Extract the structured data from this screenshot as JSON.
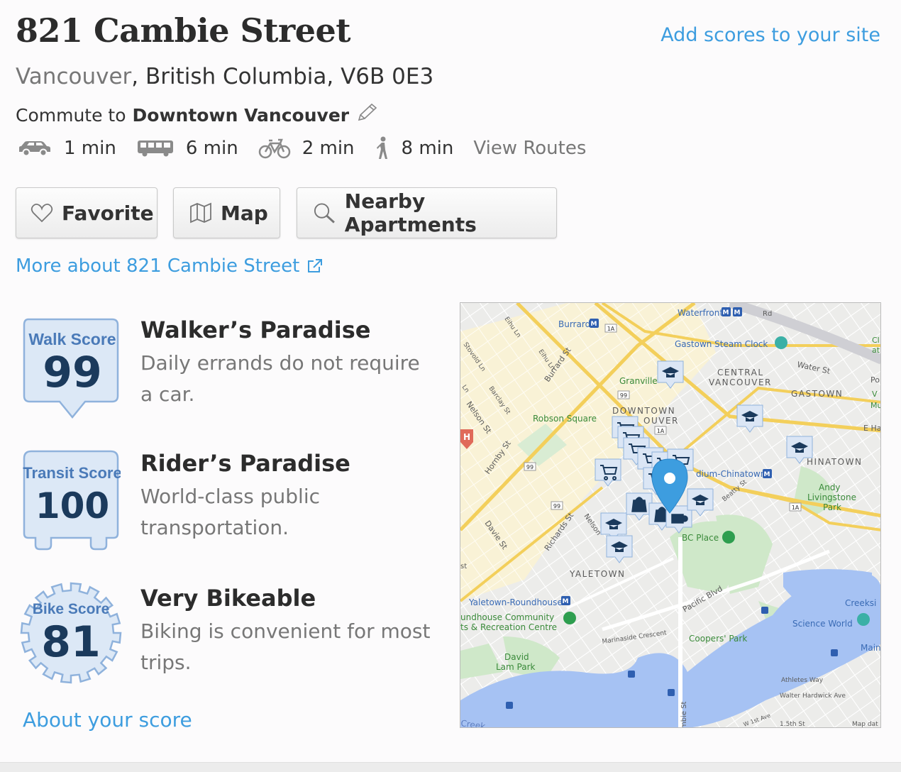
{
  "header": {
    "title": "821 Cambie Street",
    "add_scores_link": "Add scores to your site",
    "city": "Vancouver",
    "region_rest": ", British Columbia, V6B 0E3"
  },
  "commute": {
    "prefix": "Commute to",
    "destination": "Downtown Vancouver",
    "modes": [
      {
        "icon": "car-icon",
        "time": "1 min"
      },
      {
        "icon": "bus-icon",
        "time": "6 min"
      },
      {
        "icon": "bike-icon",
        "time": "2 min"
      },
      {
        "icon": "walk-icon",
        "time": "8 min"
      }
    ],
    "view_routes": "View Routes"
  },
  "buttons": {
    "favorite": "Favorite",
    "map": "Map",
    "nearby": "Nearby Apartments"
  },
  "more_about": "More about 821 Cambie Street",
  "scores": [
    {
      "badge_label": "Walk Score",
      "value": "99",
      "title": "Walker’s Paradise",
      "desc": "Daily errands do not require a car."
    },
    {
      "badge_label": "Transit Score",
      "value": "100",
      "title": "Rider’s Paradise",
      "desc": "World-class public transportation."
    },
    {
      "badge_label": "Bike Score",
      "value": "81",
      "title": "Very Bikeable",
      "desc": "Biking is convenient for most trips."
    }
  ],
  "about_score": "About your score",
  "map": {
    "labels": {
      "waterfront": "Waterfront",
      "burrard": "Burrard",
      "gastown_clock": "Gastown Steam Clock",
      "water_st": "Water St",
      "central": "CENTRAL",
      "vancouver": "VANCOUVER",
      "gastown": "GASTOWN",
      "granville": "Granville",
      "downtown": "DOWNTOWN",
      "ouver": "OUVER",
      "robson_square": "Robson Square",
      "chinatown": "HINATOWN",
      "stadium_chinatown": "dium-Chinatown",
      "andy1": "Andy",
      "andy2": "Livingstone",
      "andy3": "Park",
      "bc_place": "BC Place",
      "yaletown": "YALETOWN",
      "yaletown_rh": "Yaletown-Roundhouse",
      "roundhouse1": "undhouse Community",
      "roundhouse2": "ts & Recreation Centre",
      "pacific": "Pacific Blvd",
      "marinaside": "Marinaside Crescent",
      "coopers": "Coopers' Park",
      "science": "Science World",
      "creeksi": "Creeksi",
      "main_s": "Main S",
      "david1": "David",
      "david2": "Lam Park",
      "athletes": "Athletes Way",
      "walter": "Walter Hardwick Ave",
      "w1st": "W 1st Ave",
      "first5": "1.5th St",
      "mapdata": "Map dat",
      "creek": "Creek",
      "cambie": "mbie St",
      "hornby": "Hornby St",
      "davie": "Davie St",
      "richards": "Richards St",
      "nelson": "Nelson St",
      "nelson2": "Nelson",
      "barclay": "Barclay St",
      "stovold": "Stovold Ln",
      "eihu": "Eihu Ln",
      "burrard_st": "Burrard St",
      "beatty": "Beatty St",
      "e_ha": "E Ha",
      "po": "Po",
      "mus": "Mus",
      "cl": "Cl",
      "at": "at",
      "v": "V",
      "rd": "Rd",
      "r1a": "1A",
      "r99": "99",
      "ln": "Ln",
      "st": "st"
    }
  }
}
